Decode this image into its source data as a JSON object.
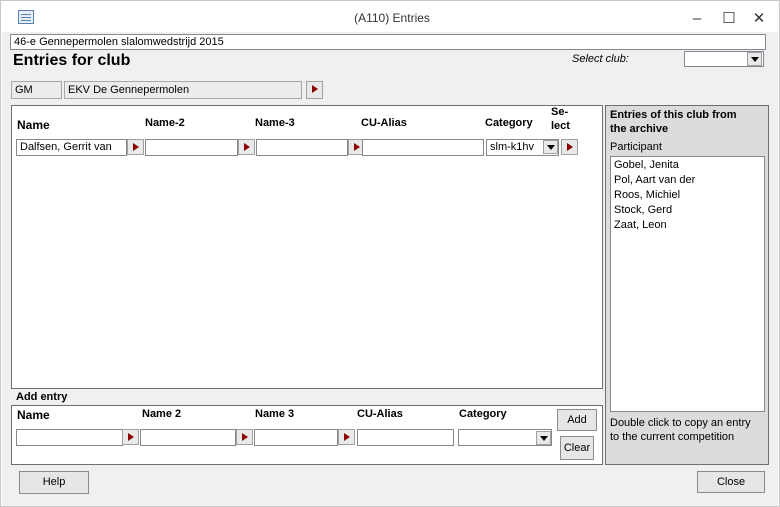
{
  "window": {
    "title": "(A110) Entries",
    "minimize_glyph": "–",
    "maximize_glyph": "☐",
    "close_glyph": "✕"
  },
  "competition": {
    "name": "46-e Gennepermolen slalomwedstrijd 2015"
  },
  "header": {
    "title": "Entries for club",
    "select_club_label": "Select  club:",
    "select_club_value": ""
  },
  "club": {
    "code": "GM",
    "name": "EKV De Gennepermolen"
  },
  "entries": {
    "columns": {
      "name": "Name",
      "name2": "Name-2",
      "name3": "Name-3",
      "cu_alias": "CU-Alias",
      "category": "Category",
      "select_line1": "Se-",
      "select_line2": "lect"
    },
    "rows": [
      {
        "name": "Dalfsen, Gerrit van",
        "name2": "",
        "name3": "",
        "cu_alias": "",
        "category": "slm-k1hv"
      }
    ]
  },
  "add_entry": {
    "title": "Add entry",
    "columns": {
      "name": "Name",
      "name2": "Name 2",
      "name3": "Name 3",
      "cu_alias": "CU-Alias",
      "category": "Category"
    },
    "values": {
      "name": "",
      "name2": "",
      "name3": "",
      "cu_alias": "",
      "category": ""
    },
    "add_label": "Add",
    "clear_label": "Clear"
  },
  "archive": {
    "title_line1": "Entries of this club from",
    "title_line2": "the archive",
    "participant_label": "Participant",
    "participants": [
      "Gobel, Jenita",
      "Pol, Aart van der",
      "Roos, Michiel",
      "Stock, Gerd",
      "Zaat, Leon"
    ],
    "hint_line1": "Double click to copy an entry",
    "hint_line2": "to the current competition"
  },
  "footer": {
    "help_label": "Help",
    "close_label": "Close"
  },
  "colors": {
    "arrow_accent": "#8b0000",
    "panel_background": "#f0f0f0"
  },
  "icons": {
    "window_icon": "form-icon",
    "row_select": "triangle-right-icon",
    "dropdown": "chevron-down-icon"
  }
}
